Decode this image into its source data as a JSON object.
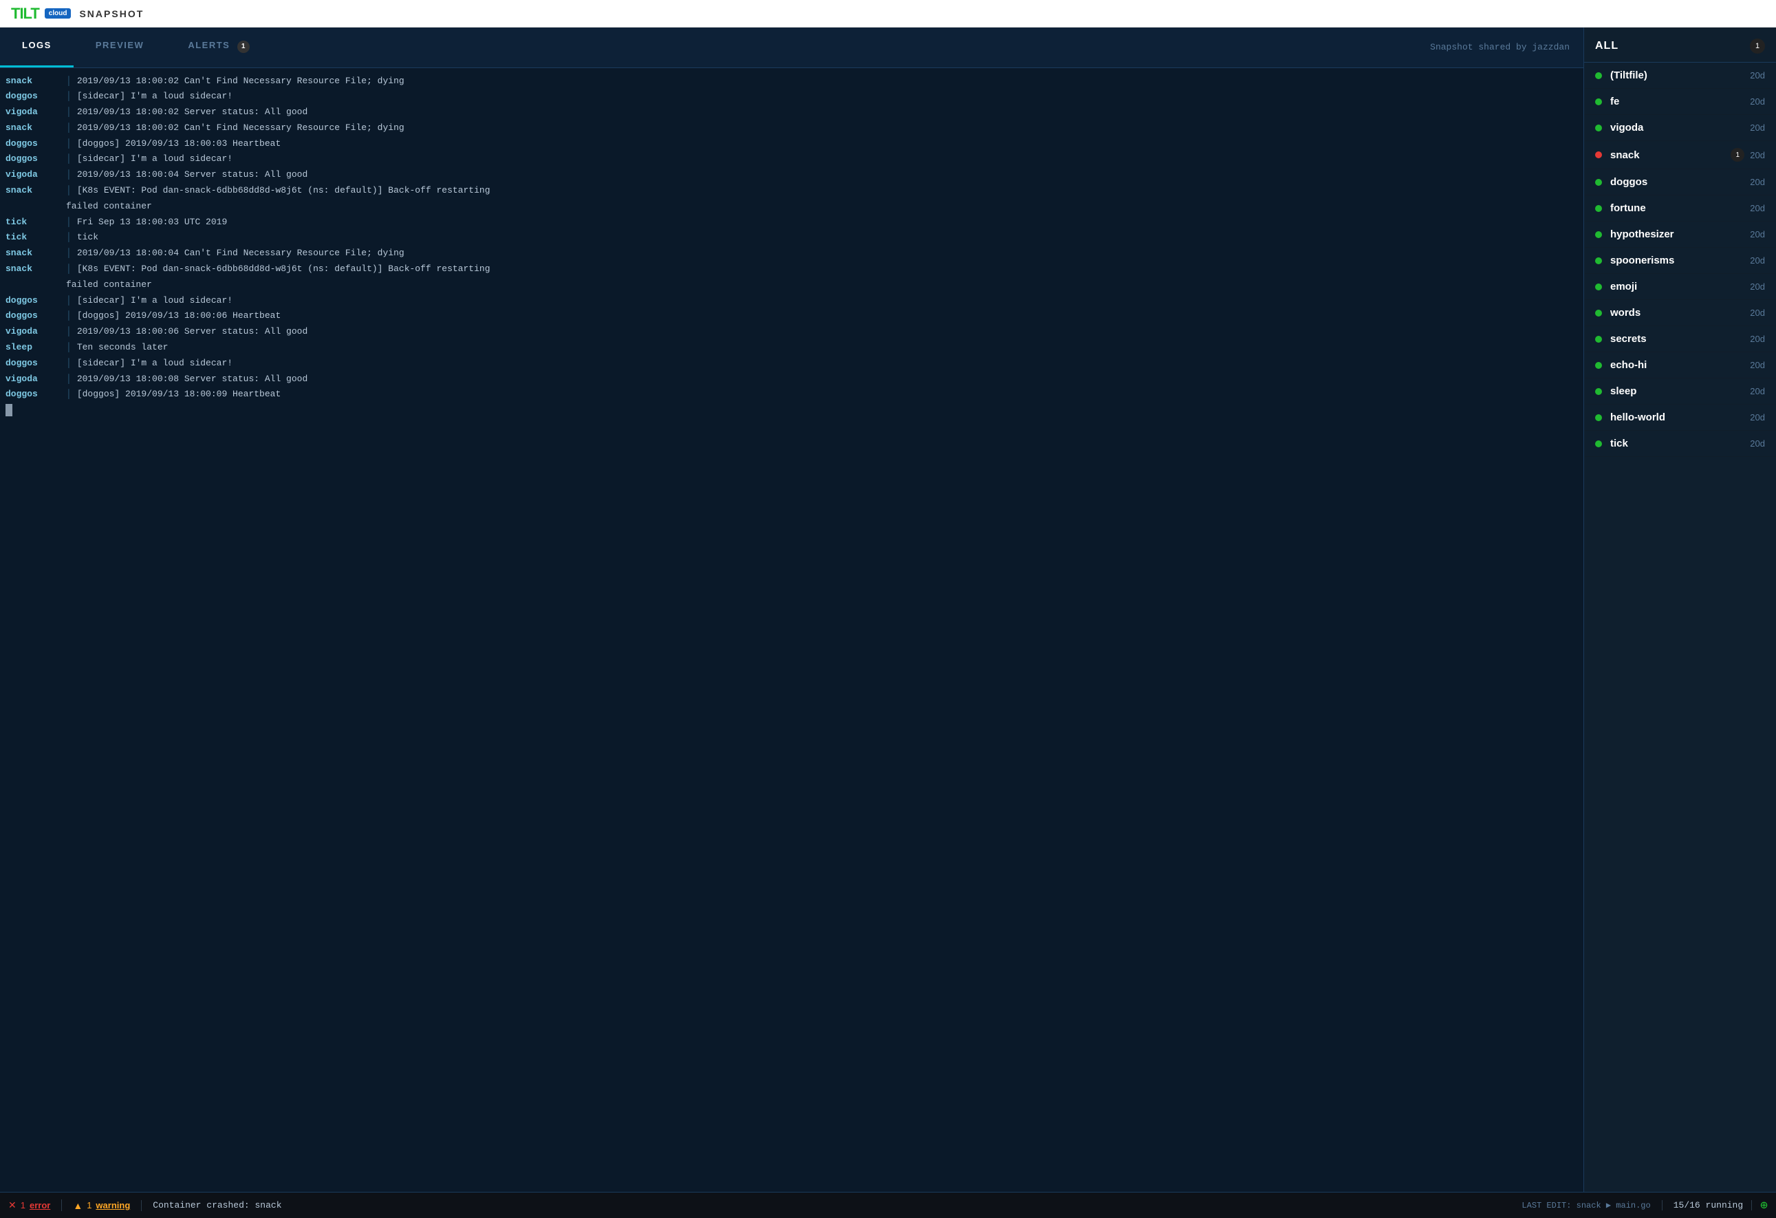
{
  "header": {
    "logo": "TILT",
    "cloud_badge": "cloud",
    "snapshot_label": "SNAPSHOT"
  },
  "tabs": [
    {
      "id": "logs",
      "label": "LOGS",
      "active": true,
      "badge": null
    },
    {
      "id": "preview",
      "label": "PREVIEW",
      "active": false,
      "badge": null
    },
    {
      "id": "alerts",
      "label": "ALERTS",
      "active": false,
      "badge": "1"
    }
  ],
  "snapshot_info": "Snapshot shared by jazzdan",
  "log_entries": [
    {
      "service": "snack",
      "message": "2019/09/13 18:00:02 Can't Find Necessary Resource File; dying",
      "continuation": false
    },
    {
      "service": "doggos",
      "message": "[sidecar] I'm a loud sidecar!",
      "continuation": false
    },
    {
      "service": "vigoda",
      "message": "2019/09/13 18:00:02 Server status: All good",
      "continuation": false
    },
    {
      "service": "snack",
      "message": "2019/09/13 18:00:02 Can't Find Necessary Resource File; dying",
      "continuation": false
    },
    {
      "service": "doggos",
      "message": "[doggos] 2019/09/13 18:00:03 Heartbeat",
      "continuation": false
    },
    {
      "service": "doggos",
      "message": "[sidecar] I'm a loud sidecar!",
      "continuation": false
    },
    {
      "service": "vigoda",
      "message": "2019/09/13 18:00:04 Server status: All good",
      "continuation": false
    },
    {
      "service": "snack",
      "message": "[K8s EVENT: Pod dan-snack-6dbb68dd8d-w8j6t (ns: default)] Back-off restarting",
      "continuation": true,
      "continuation_text": "failed container"
    },
    {
      "service": "tick",
      "message": "Fri Sep 13 18:00:03 UTC 2019",
      "continuation": false
    },
    {
      "service": "tick",
      "message": "tick",
      "continuation": false
    },
    {
      "service": "snack",
      "message": "2019/09/13 18:00:04 Can't Find Necessary Resource File; dying",
      "continuation": false
    },
    {
      "service": "snack",
      "message": "[K8s EVENT: Pod dan-snack-6dbb68dd8d-w8j6t (ns: default)] Back-off restarting",
      "continuation": true,
      "continuation_text": "failed container"
    },
    {
      "service": "doggos",
      "message": "[sidecar] I'm a loud sidecar!",
      "continuation": false
    },
    {
      "service": "doggos",
      "message": "[doggos] 2019/09/13 18:00:06 Heartbeat",
      "continuation": false
    },
    {
      "service": "vigoda",
      "message": "2019/09/13 18:00:06 Server status: All good",
      "continuation": false
    },
    {
      "service": "sleep",
      "message": "Ten seconds later",
      "continuation": false
    },
    {
      "service": "doggos",
      "message": "[sidecar] I'm a loud sidecar!",
      "continuation": false
    },
    {
      "service": "vigoda",
      "message": "2019/09/13 18:00:08 Server status: All good",
      "continuation": false
    },
    {
      "service": "doggos",
      "message": "[doggos] 2019/09/13 18:00:09 Heartbeat",
      "continuation": false
    }
  ],
  "sidebar": {
    "header_label": "ALL",
    "count_badge": "1",
    "items": [
      {
        "name": "(Tiltfile)",
        "status": "green",
        "time": "20d",
        "alert_badge": null
      },
      {
        "name": "fe",
        "status": "green",
        "time": "20d",
        "alert_badge": null
      },
      {
        "name": "vigoda",
        "status": "green",
        "time": "20d",
        "alert_badge": null
      },
      {
        "name": "snack",
        "status": "red",
        "time": "20d",
        "alert_badge": "1"
      },
      {
        "name": "doggos",
        "status": "green",
        "time": "20d",
        "alert_badge": null
      },
      {
        "name": "fortune",
        "status": "green",
        "time": "20d",
        "alert_badge": null
      },
      {
        "name": "hypothesizer",
        "status": "green",
        "time": "20d",
        "alert_badge": null
      },
      {
        "name": "spoonerisms",
        "status": "green",
        "time": "20d",
        "alert_badge": null
      },
      {
        "name": "emoji",
        "status": "green",
        "time": "20d",
        "alert_badge": null
      },
      {
        "name": "words",
        "status": "green",
        "time": "20d",
        "alert_badge": null
      },
      {
        "name": "secrets",
        "status": "green",
        "time": "20d",
        "alert_badge": null
      },
      {
        "name": "echo-hi",
        "status": "green",
        "time": "20d",
        "alert_badge": null
      },
      {
        "name": "sleep",
        "status": "green",
        "time": "20d",
        "alert_badge": null
      },
      {
        "name": "hello-world",
        "status": "green",
        "time": "20d",
        "alert_badge": null
      },
      {
        "name": "tick",
        "status": "green",
        "time": "20d",
        "alert_badge": null
      }
    ]
  },
  "statusbar": {
    "error_count": "1",
    "error_label": "error",
    "warning_count": "1",
    "warning_label": "warning",
    "crash_message": "Container crashed: snack",
    "last_edit_label": "LAST EDIT:",
    "last_edit_service": "snack",
    "last_edit_file": "main.go",
    "running_fraction": "15/16",
    "running_label": "running"
  }
}
